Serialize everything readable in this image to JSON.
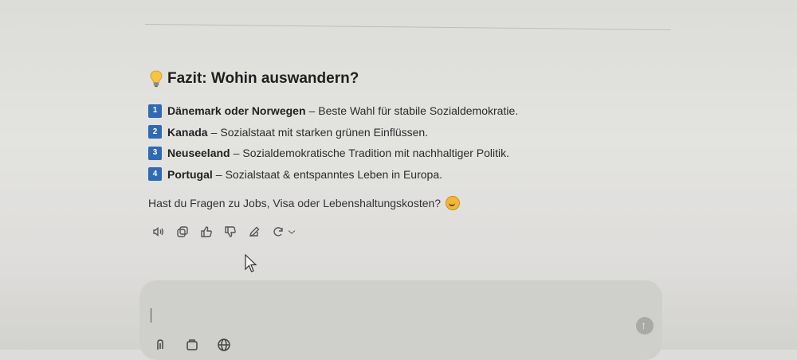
{
  "heading": "Fazit: Wohin auswandern?",
  "items": [
    {
      "num": "1",
      "title": "Dänemark oder Norwegen",
      "desc": "Beste Wahl für stabile Sozialdemokratie."
    },
    {
      "num": "2",
      "title": "Kanada",
      "desc": "Sozialstaat mit starken grünen Einflüssen."
    },
    {
      "num": "3",
      "title": "Neuseeland",
      "desc": "Sozialdemokratische Tradition mit nachhaltiger Politik."
    },
    {
      "num": "4",
      "title": "Portugal",
      "desc": "Sozialstaat & entspanntes Leben in Europa."
    }
  ],
  "separator": "–",
  "question": "Hast du Fragen zu Jobs, Visa oder Lebenshaltungskosten?",
  "icons": {
    "heading": "lightbulb-icon",
    "question": "smiling-face-icon",
    "actions": [
      "read-aloud-icon",
      "copy-icon",
      "thumbs-up-icon",
      "thumbs-down-icon",
      "edit-icon",
      "regenerate-icon"
    ],
    "composer_tools": [
      "attach-icon",
      "tools-icon",
      "globe-icon"
    ],
    "send": "send-arrow-icon"
  },
  "colors": {
    "number_badge": "#2f6ab3",
    "background": "#e3e3e0",
    "composer": "#cfcfcc"
  }
}
